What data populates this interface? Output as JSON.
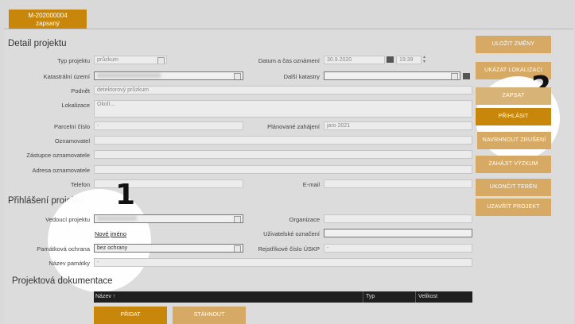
{
  "header": {
    "tab_id": "M-202000004",
    "tab_status": "zapsaný"
  },
  "detail": {
    "title": "Detail projektu",
    "typ_label": "Typ projektu",
    "typ_value": "průzkum",
    "datum_label": "Datum a čas oznámení",
    "datum_value": "30.9.2020",
    "cas_value": "19:39",
    "katastr_label": "Katastrální území",
    "dalsi_label": "Další katastry",
    "podnet_label": "Podnět",
    "podnet_value": "detektorový průzkum",
    "lokalizace_label": "Lokalizace",
    "lokalizace_placeholder": "Okolí...",
    "parcelni_label": "Parcelní číslo",
    "parcelni_value": "-",
    "planovane_label": "Plánované zahájení",
    "planovane_value": "jaro 2021",
    "oznamovatel_label": "Oznamovatel",
    "zastupce_label": "Zástupce oznamovatele",
    "adresa_label": "Adresa oznamovatele",
    "telefon_label": "Telefon",
    "email_label": "E-mail"
  },
  "prihlaseni": {
    "title": "Přihlášení projektu",
    "vedouci_label": "Vedoucí projektu",
    "organizace_label": "Organizace",
    "nove_jmeno": "Nové jméno",
    "uzivatelske_label": "Uživatelské označení",
    "pamatkova_label": "Památková ochrana",
    "pamatkova_value": "bez ochrany",
    "rejstrikove_label": "Rejstříkové číslo ÚSKP",
    "rejstrikove_value": "-",
    "nazev_pamatky_label": "Název památky",
    "nazev_pamatky_value": "-"
  },
  "dokumentace": {
    "title": "Projektová dokumentace",
    "columns": [
      "Název ↑",
      "Typ",
      "Velikost"
    ],
    "pridat": "PŘIDAT",
    "stahnout": "STÁHNOUT"
  },
  "actions": [
    "ULOŽIT ZMĚNY",
    "UKÁZAT LOKALIZACI",
    "ZAPSAT",
    "PŘIHLÁSIT",
    "NAVRHNOUT ZRUŠENÍ",
    "ZAHÁJIT VÝZKUM",
    "UKONČIT TERÉN",
    "UZAVŘÍT PROJEKT"
  ],
  "annotations": {
    "one": "1",
    "two": "2"
  },
  "colors": {
    "accent": "#c8860b",
    "accent_pale": "#d6a964",
    "panel": "#dcdcdc"
  }
}
